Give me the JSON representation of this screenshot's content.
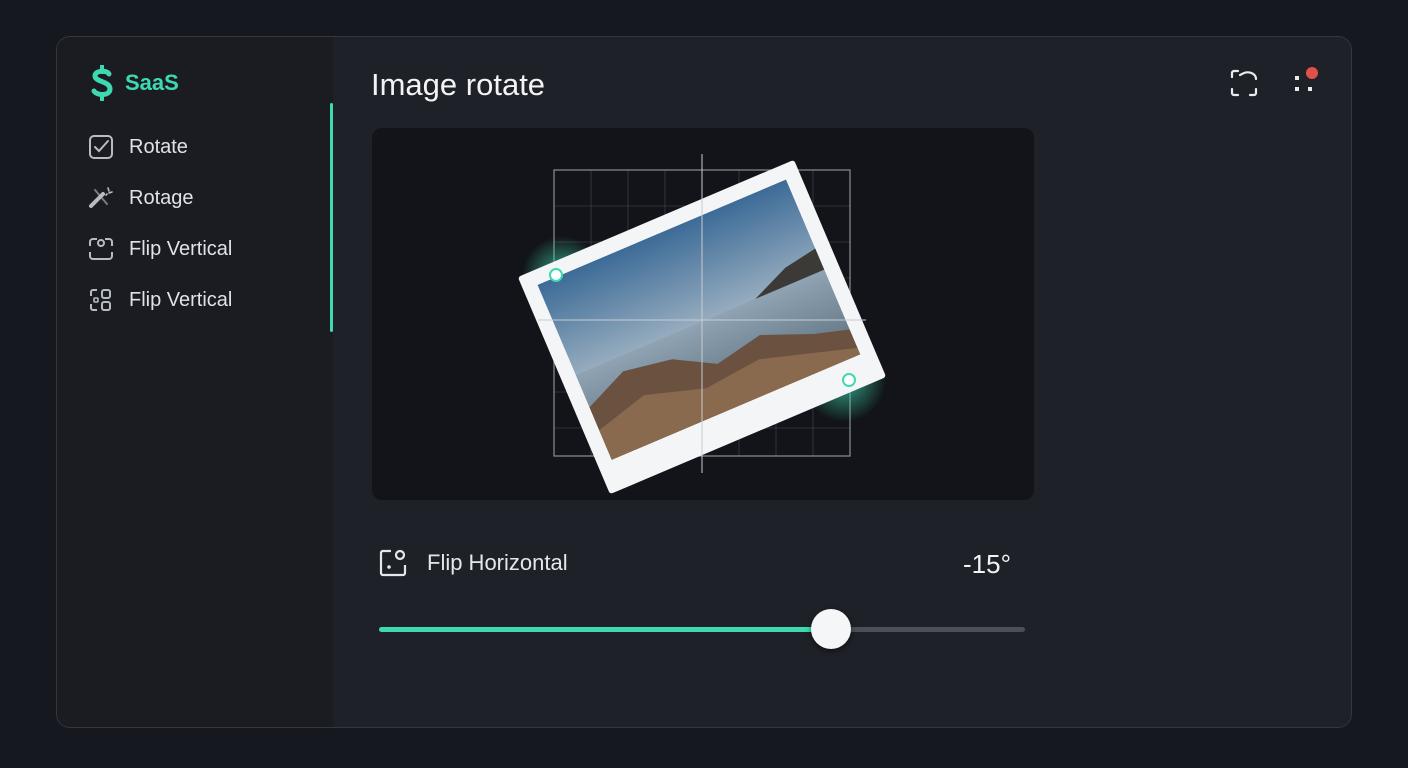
{
  "app": {
    "logo_text": "SaaS",
    "accent_color": "#3fd9b1",
    "logo_icon": "dollar-s-icon"
  },
  "sidebar": {
    "items": [
      {
        "label": "Rotate",
        "icon": "checkbox-icon"
      },
      {
        "label": "Rotage",
        "icon": "wand-icon"
      },
      {
        "label": "Flip Vertical",
        "icon": "flip-vertical-icon"
      },
      {
        "label": "Flip Vertical",
        "icon": "grid-flip-icon"
      }
    ]
  },
  "header": {
    "title": "Image rotate",
    "actions": [
      {
        "icon": "crop-corners-icon"
      },
      {
        "icon": "more-dots-icon",
        "has_notification": true,
        "notification_color": "#e2504c"
      }
    ]
  },
  "editor": {
    "image_subject": "coastal sunset photo",
    "rotation_degrees": -15
  },
  "control": {
    "label": "Flip Horizontal",
    "icon": "flip-horizontal-icon",
    "value_text": "-15°",
    "slider_fraction": 0.7
  }
}
